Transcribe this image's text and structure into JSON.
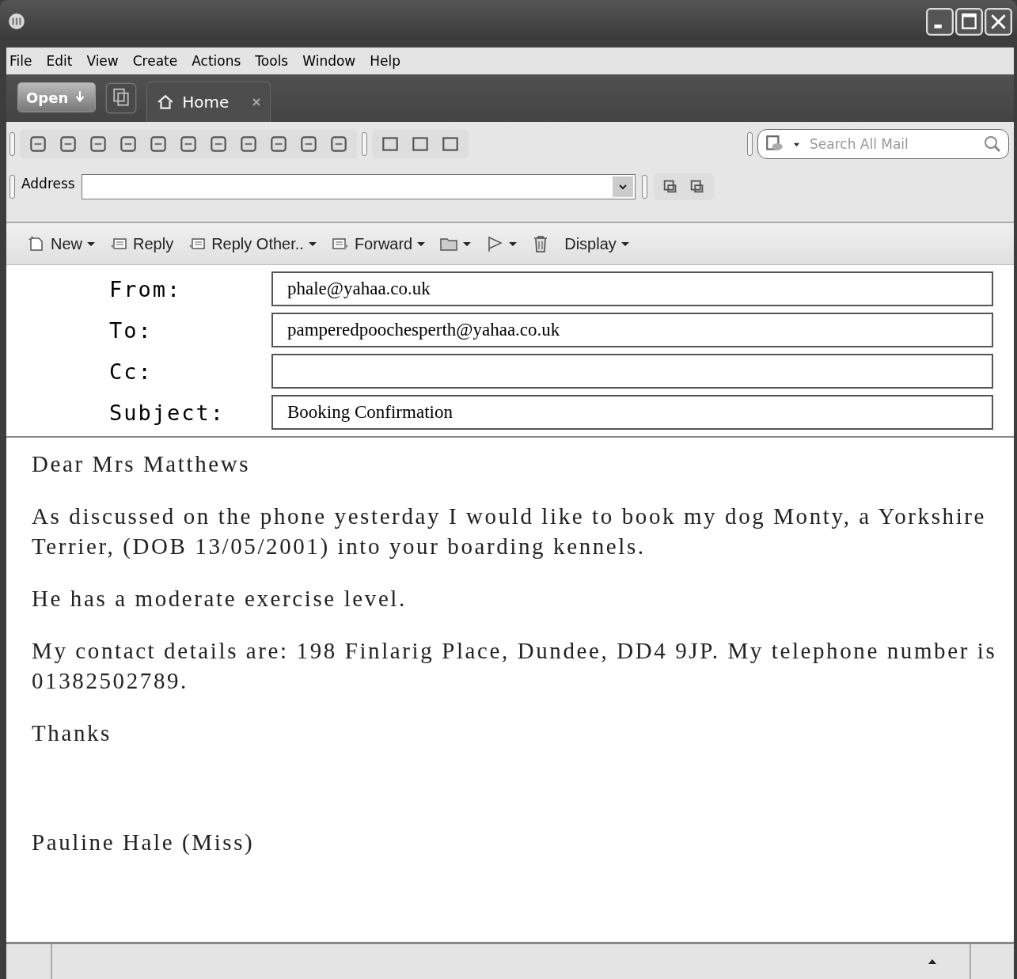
{
  "menu": [
    "File",
    "Edit",
    "View",
    "Create",
    "Actions",
    "Tools",
    "Window",
    "Help"
  ],
  "tab_bar": {
    "open_button": "Open",
    "tabs": [
      {
        "label": "Home",
        "selected": true
      }
    ]
  },
  "search": {
    "placeholder": "Search All Mail"
  },
  "address": {
    "label": "Address"
  },
  "actions": [
    {
      "kind": "new",
      "label": "New",
      "dropdown": true
    },
    {
      "kind": "reply",
      "label": "Reply",
      "dropdown": false
    },
    {
      "kind": "reply",
      "label": "Reply Other..",
      "dropdown": true
    },
    {
      "kind": "forward",
      "label": "Forward",
      "dropdown": true
    },
    {
      "kind": "folder",
      "dropdown": true
    },
    {
      "kind": "flag",
      "dropdown": true
    },
    {
      "kind": "trash",
      "dropdown": false
    },
    {
      "kind": "display",
      "label": "Display",
      "dropdown": true
    }
  ],
  "headers": [
    {
      "label": "From:",
      "value": "phale@yahaa.co.uk"
    },
    {
      "label": "To:",
      "value": "pamperedpoochesperth@yahaa.co.uk"
    },
    {
      "label": "Cc:"
    },
    {
      "label": "Subject:",
      "value": "Booking Confirmation"
    }
  ],
  "body": {
    "paragraphs": [
      "Dear Mrs Matthews",
      "As discussed on the phone yesterday I would like to book my dog Monty, a Yorkshire Terrier, (DOB 13/05/2001) into your boarding kennels.",
      "He has a moderate exercise level.",
      "My contact details are: 198 Finlarig Place, Dundee, DD4 9JP.  My telephone number is 01382502789.",
      "Thanks"
    ],
    "signature": "Pauline Hale (Miss)"
  }
}
